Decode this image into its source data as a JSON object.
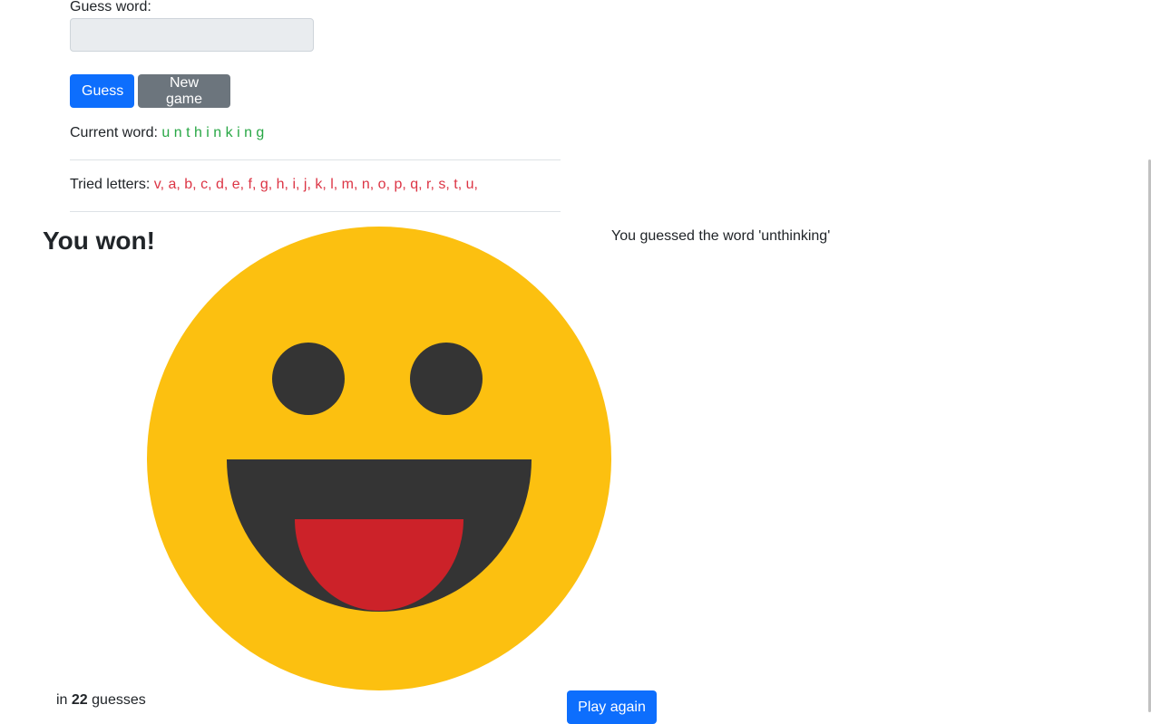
{
  "form": {
    "guess_label": "Guess word:",
    "guess_value": "",
    "guess_button": "Guess",
    "new_game_button": "New game"
  },
  "current_word": {
    "label": "Current word:",
    "letters": "u n t h i n k i n g"
  },
  "tried_letters": {
    "label": "Tried letters:",
    "letters": "v, a, b, c, d, e, f, g, h, i, j, k, l, m, n, o, p, q, r, s, t, u,"
  },
  "result": {
    "title": "You won!",
    "message": "You guessed the word 'unthinking'",
    "count_prefix": "in",
    "count": "22",
    "count_suffix": "guesses",
    "play_again_button": "Play again"
  },
  "smiley": {
    "icon": "grinning-face-icon",
    "face_color": "#fcc010",
    "feature_color": "#343434",
    "tongue_color": "#cc2229"
  },
  "colors": {
    "primary": "#0d6efd",
    "secondary": "#6c757d",
    "correct": "#28a745",
    "wrong": "#dc3545"
  }
}
